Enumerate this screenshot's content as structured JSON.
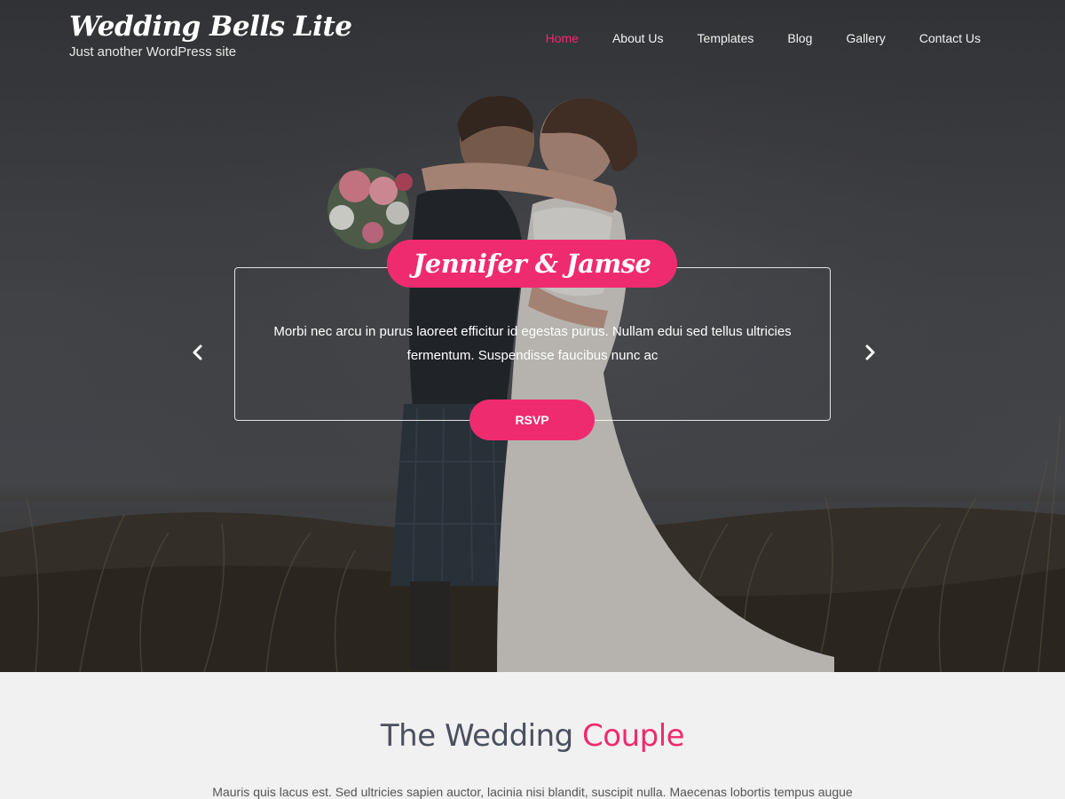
{
  "header": {
    "site_title": "Wedding Bells Lite",
    "tagline": "Just another WordPress site",
    "nav": [
      {
        "label": "Home",
        "active": true
      },
      {
        "label": "About Us",
        "active": false
      },
      {
        "label": "Templates",
        "active": false
      },
      {
        "label": "Blog",
        "active": false
      },
      {
        "label": "Gallery",
        "active": false
      },
      {
        "label": "Contact Us",
        "active": false
      }
    ]
  },
  "slider": {
    "title": "Jennifer & Jamse",
    "text": "Morbi nec arcu in purus laoreet efficitur id egestas purus. Nullam edui sed tellus ultricies fermentum. Suspendisse faucibus nunc ac",
    "button_label": "RSVP",
    "prev_icon": "chevron-left-icon",
    "next_icon": "chevron-right-icon"
  },
  "couple": {
    "heading_part1": "The Wedding ",
    "heading_part2": "Couple",
    "text": "Mauris quis lacus est. Sed ultricies sapien auctor, lacinia nisi blandit, suscipit nulla. Maecenas lobortis tempus augue"
  },
  "colors": {
    "accent": "#ef2b70",
    "heading": "#4b5060",
    "section_bg": "#f1f1f1"
  }
}
